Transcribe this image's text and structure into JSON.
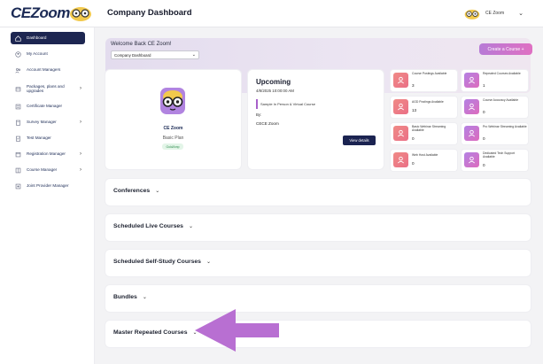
{
  "app": {
    "logo_text": "CEZoom",
    "page_title": "Company Dashboard",
    "user_name": "CE Zoom"
  },
  "icons": {
    "logo_mascot": "owl-glasses-icon",
    "user_avatar": "owl-glasses-icon",
    "user_chevron": "chevron-down-icon"
  },
  "sidebar": {
    "items": [
      {
        "label": "Dashboard",
        "icon": "home-icon",
        "active": true,
        "has_submenu": false
      },
      {
        "label": "My Account",
        "icon": "user-circle-icon",
        "active": false,
        "has_submenu": false
      },
      {
        "label": "Account Managers",
        "icon": "users-icon",
        "active": false,
        "has_submenu": false
      },
      {
        "label": "Packages, plans and upgrades",
        "icon": "box-icon",
        "active": false,
        "has_submenu": true
      },
      {
        "label": "Certificate Manager",
        "icon": "certificate-icon",
        "active": false,
        "has_submenu": false
      },
      {
        "label": "Survey Manager",
        "icon": "survey-icon",
        "active": false,
        "has_submenu": true
      },
      {
        "label": "Test Manager",
        "icon": "test-icon",
        "active": false,
        "has_submenu": false
      },
      {
        "label": "Registration Manager",
        "icon": "registration-icon",
        "active": false,
        "has_submenu": true
      },
      {
        "label": "Course Manager",
        "icon": "course-icon",
        "active": false,
        "has_submenu": true
      },
      {
        "label": "Joint Provider Manager",
        "icon": "joint-provider-icon",
        "active": false,
        "has_submenu": false
      }
    ],
    "submenu_glyph": "›"
  },
  "welcome": {
    "title": "Welcome Back CE Zoom!",
    "select_value": "Company Dashboard",
    "create_button": "Create a Course +"
  },
  "profile": {
    "name": "CE Zoom",
    "plan": "Basic Plan",
    "badge": "Gold/Amp"
  },
  "upcoming": {
    "title": "Upcoming",
    "date": "4/8/2025 10:00:00 AM",
    "course": "Sample In Person & Virtual Course",
    "by_label": "By:",
    "by_name": "CECE Zoom",
    "details_button": "View details"
  },
  "stats": [
    {
      "label": "Course Postings Available",
      "value": "3",
      "color": "red"
    },
    {
      "label": "Repeated Courses Available",
      "value": "1",
      "color": "purple"
    },
    {
      "label": "AGD Postings Available",
      "value": "13",
      "color": "red"
    },
    {
      "label": "Course Accuracy Available",
      "value": "0",
      "color": "purple"
    },
    {
      "label": "Basic Webinar Streaming Available",
      "value": "0",
      "color": "red"
    },
    {
      "label": "Pro Webinar Streaming Available",
      "value": "0",
      "color": "purple"
    },
    {
      "label": "Web Host Available",
      "value": "0",
      "color": "red"
    },
    {
      "label": "Dedicated Tech Support Available",
      "value": "0",
      "color": "purple"
    }
  ],
  "sections": [
    {
      "title": "Conferences"
    },
    {
      "title": "Scheduled Live Courses"
    },
    {
      "title": "Scheduled Self-Study Courses"
    },
    {
      "title": "Bundles"
    },
    {
      "title": "Master Repeated Courses"
    }
  ],
  "colors": {
    "brand_navy": "#1d2651",
    "accent_purple": "#b570d3",
    "stat_red": "#ee7e86",
    "stat_purple": "#c277d6",
    "annotation_arrow": "#b86fd2"
  }
}
